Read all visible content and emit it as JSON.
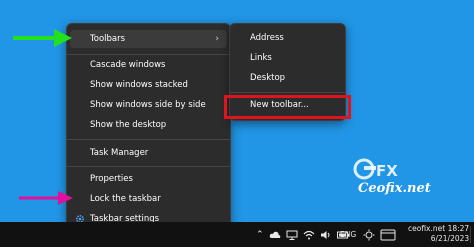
{
  "menu": {
    "items": [
      {
        "label": "Toolbars",
        "has_submenu": true
      },
      {
        "label": "Cascade windows"
      },
      {
        "label": "Show windows stacked"
      },
      {
        "label": "Show windows side by side"
      },
      {
        "label": "Show the desktop"
      },
      {
        "label": "Task Manager"
      },
      {
        "label": "Properties"
      },
      {
        "label": "Lock the taskbar"
      },
      {
        "label": "Taskbar settings",
        "icon": "gear-icon"
      }
    ],
    "chevron": "›"
  },
  "submenu": {
    "items": [
      {
        "label": "Address"
      },
      {
        "label": "Links"
      },
      {
        "label": "Desktop"
      },
      {
        "label": "New toolbar..."
      }
    ],
    "highlight_color": "#e0141c"
  },
  "annotations": {
    "green_arrow_color": "#22e01f",
    "pink_arrow_color": "#e0109b"
  },
  "watermark": {
    "logo_text": "CEFX",
    "site_text": "Ceofix.net"
  },
  "taskbar": {
    "tray_icons": [
      "chevron-up-icon",
      "cloud-icon",
      "monitor-icon",
      "wifi-icon",
      "speaker-icon",
      "battery-icon"
    ],
    "language": "ENG",
    "clock_line1": "ceofix.net 18:27",
    "clock_line2": "6/21/2023"
  },
  "colors": {
    "desktop": "#2196e6",
    "menu_bg": "#2c2c2c",
    "taskbar": "#111111"
  }
}
